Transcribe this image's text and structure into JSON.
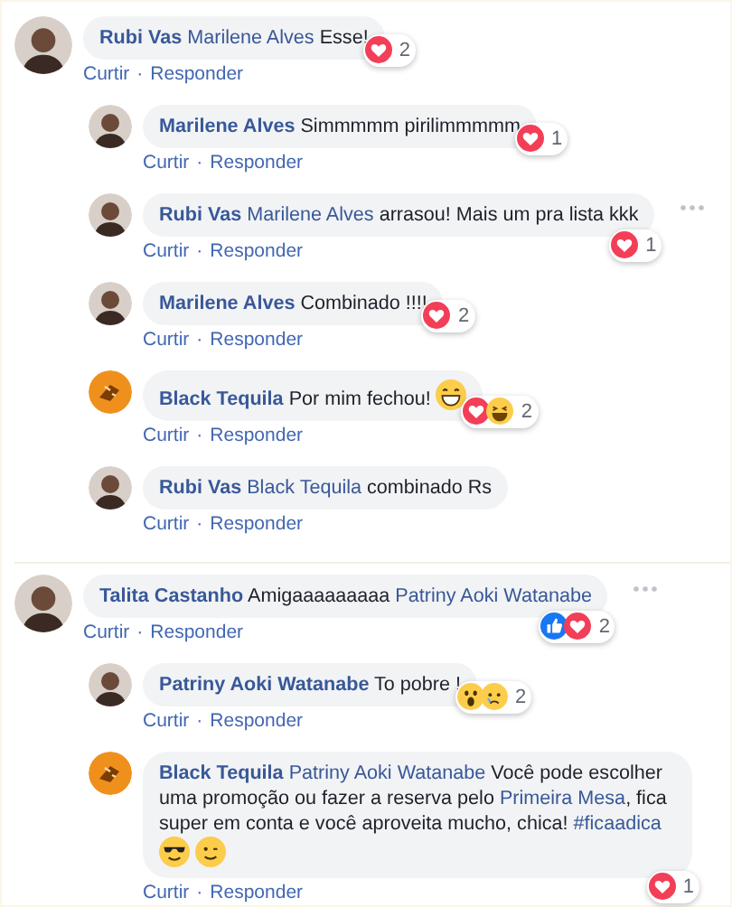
{
  "threads": [
    {
      "comment": {
        "avatar": {
          "kind": "person"
        },
        "parts": [
          {
            "kind": "author",
            "text": "Rubi Vas"
          },
          {
            "kind": "mention",
            "text": "Marilene Alves"
          },
          {
            "kind": "text",
            "text": "Esse!"
          }
        ],
        "reactions": {
          "types": [
            {
              "kind": "love"
            }
          ],
          "count": "2"
        },
        "more_button": false,
        "actions": {
          "like": "Curtir",
          "separator": "·",
          "reply": "Responder"
        }
      },
      "replies": [
        {
          "avatar": {
            "kind": "person"
          },
          "parts": [
            {
              "kind": "author",
              "text": "Marilene Alves"
            },
            {
              "kind": "text",
              "text": "Simmmmm pirilimmmmm"
            }
          ],
          "reactions": {
            "types": [
              {
                "kind": "love"
              }
            ],
            "count": "1"
          },
          "more_button": false,
          "actions": {
            "like": "Curtir",
            "separator": "·",
            "reply": "Responder"
          }
        },
        {
          "avatar": {
            "kind": "person"
          },
          "parts": [
            {
              "kind": "author",
              "text": "Rubi Vas"
            },
            {
              "kind": "mention",
              "text": "Marilene Alves"
            },
            {
              "kind": "text",
              "text": "arrasou! Mais um pra lista kkk"
            }
          ],
          "reactions": {
            "types": [
              {
                "kind": "love"
              }
            ],
            "count": "1"
          },
          "more_button": true,
          "actions": {
            "like": "Curtir",
            "separator": "·",
            "reply": "Responder"
          }
        },
        {
          "avatar": {
            "kind": "person"
          },
          "parts": [
            {
              "kind": "author",
              "text": "Marilene Alves"
            },
            {
              "kind": "text",
              "text": "Combinado !!!!"
            }
          ],
          "reactions": {
            "types": [
              {
                "kind": "love"
              }
            ],
            "count": "2"
          },
          "more_button": false,
          "actions": {
            "like": "Curtir",
            "separator": "·",
            "reply": "Responder"
          }
        },
        {
          "avatar": {
            "kind": "logo"
          },
          "parts": [
            {
              "kind": "author",
              "text": "Black Tequila"
            },
            {
              "kind": "text",
              "text": "Por mim fechou!"
            },
            {
              "kind": "grin"
            }
          ],
          "reactions": {
            "types": [
              {
                "kind": "love"
              },
              {
                "kind": "haha"
              }
            ],
            "count": "2"
          },
          "more_button": false,
          "actions": {
            "like": "Curtir",
            "separator": "·",
            "reply": "Responder"
          }
        },
        {
          "avatar": {
            "kind": "person"
          },
          "parts": [
            {
              "kind": "author",
              "text": "Rubi Vas"
            },
            {
              "kind": "mention",
              "text": "Black Tequila"
            },
            {
              "kind": "text",
              "text": "combinado Rs"
            }
          ],
          "more_button": false,
          "actions": {
            "like": "Curtir",
            "separator": "·",
            "reply": "Responder"
          }
        }
      ]
    },
    {
      "comment": {
        "avatar": {
          "kind": "person"
        },
        "parts": [
          {
            "kind": "author",
            "text": "Talita Castanho"
          },
          {
            "kind": "text",
            "text": "Amigaaaaaaaaa"
          },
          {
            "kind": "mention",
            "text": "Patriny Aoki Watanabe"
          }
        ],
        "reactions": {
          "types": [
            {
              "kind": "like"
            },
            {
              "kind": "love"
            }
          ],
          "count": "2"
        },
        "more_button": true,
        "actions": {
          "like": "Curtir",
          "separator": "·",
          "reply": "Responder"
        }
      },
      "replies": [
        {
          "avatar": {
            "kind": "person"
          },
          "parts": [
            {
              "kind": "author",
              "text": "Patriny Aoki Watanabe"
            },
            {
              "kind": "text",
              "text": "To pobre !"
            }
          ],
          "reactions": {
            "types": [
              {
                "kind": "wow"
              },
              {
                "kind": "sad"
              }
            ],
            "count": "2"
          },
          "more_button": false,
          "actions": {
            "like": "Curtir",
            "separator": "·",
            "reply": "Responder"
          }
        },
        {
          "avatar": {
            "kind": "logo"
          },
          "parts": [
            {
              "kind": "author",
              "text": "Black Tequila"
            },
            {
              "kind": "mention",
              "text": "Patriny Aoki Watanabe"
            },
            {
              "kind": "text",
              "text": "Você pode escolher uma promoção ou fazer a reserva pelo"
            },
            {
              "kind": "mention",
              "text": "Primeira Mesa"
            },
            {
              "kind": "text",
              "text": ", fica super em conta e você aproveita mucho, chica!"
            },
            {
              "kind": "hashtag",
              "text": "#ficaadica"
            },
            {
              "kind": "break"
            },
            {
              "kind": "cool"
            },
            {
              "kind": "smile"
            }
          ],
          "reactions": {
            "types": [
              {
                "kind": "love"
              }
            ],
            "count": "1"
          },
          "more_button": false,
          "actions": {
            "like": "Curtir",
            "separator": "·",
            "reply": "Responder"
          }
        }
      ]
    }
  ]
}
